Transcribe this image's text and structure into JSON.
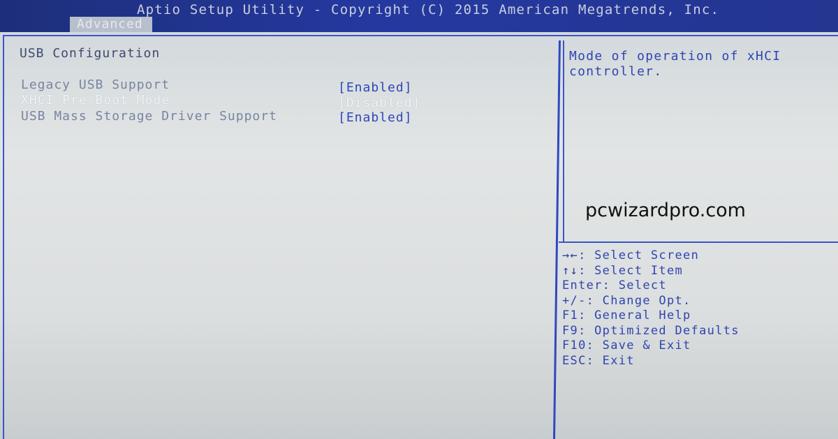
{
  "header": {
    "title": "Aptio Setup Utility - Copyright (C) 2015 American Megatrends, Inc.",
    "tab_label": "Advanced"
  },
  "main": {
    "section_title": "USB Configuration",
    "items": [
      {
        "label": "Legacy USB Support",
        "value": "[Enabled]"
      },
      {
        "label": "XHCI Pre-Boot Mode",
        "value": "[Disabled]"
      },
      {
        "label": "USB Mass Storage Driver Support",
        "value": "[Enabled]"
      }
    ]
  },
  "help": {
    "text": "Mode of operation of xHCI controller."
  },
  "watermark": "pcwizardpro.com",
  "keys": [
    {
      "icon": "→←",
      "text": ": Select Screen"
    },
    {
      "icon": "↑↓",
      "text": ": Select Item"
    },
    {
      "icon": "",
      "text": "Enter: Select"
    },
    {
      "icon": "",
      "text": "+/-: Change Opt."
    },
    {
      "icon": "",
      "text": "F1: General Help"
    },
    {
      "icon": "",
      "text": "F9: Optimized Defaults"
    },
    {
      "icon": "",
      "text": "F10: Save & Exit"
    },
    {
      "icon": "",
      "text": "ESC: Exit"
    }
  ]
}
